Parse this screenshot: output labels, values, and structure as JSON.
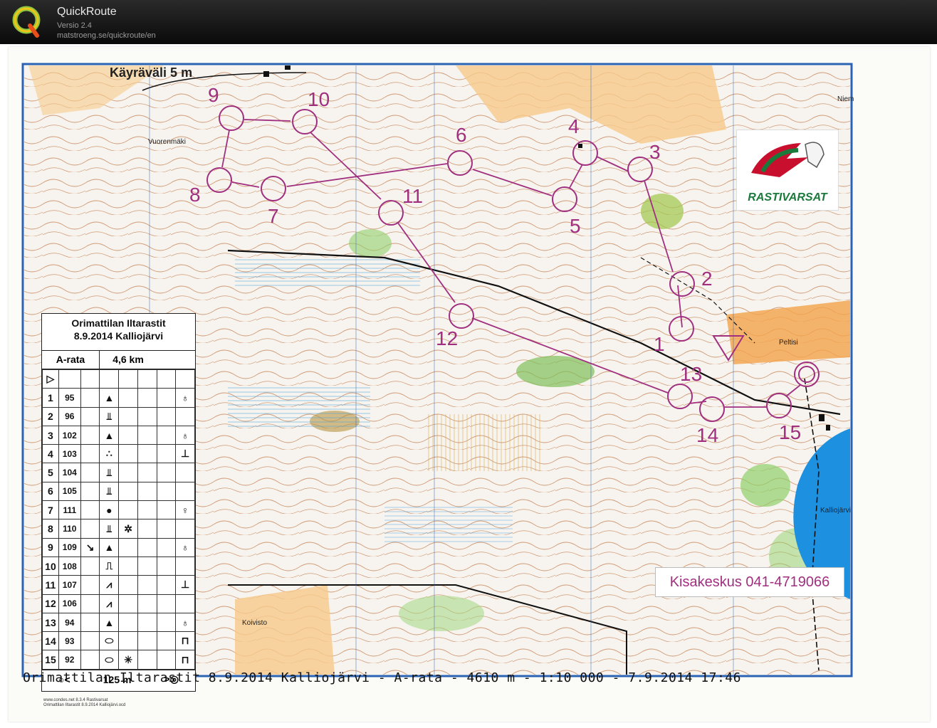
{
  "app": {
    "title": "QuickRoute",
    "version": "Versio 2.4",
    "url": "matstroeng.se/quickroute/en"
  },
  "map": {
    "contour_label": "Käyräväli 5 m",
    "brand": "RASTIVARSAT",
    "hq_label": "Kisakeskus 041-4719066",
    "place_labels": [
      "Vuorenmäki",
      "Koivisto",
      "Peltisi",
      "Kalliojärvi",
      "Niem"
    ],
    "caption": "Orimattilan Iltarastit 8.9.2014 Kalliojärvi - A-rata - 4610 m - 1:10 000 - 7.9.2014 17:46"
  },
  "controls": [
    {
      "n": "1"
    },
    {
      "n": "2"
    },
    {
      "n": "3"
    },
    {
      "n": "4"
    },
    {
      "n": "5"
    },
    {
      "n": "6"
    },
    {
      "n": "7"
    },
    {
      "n": "8"
    },
    {
      "n": "9"
    },
    {
      "n": "10"
    },
    {
      "n": "11"
    },
    {
      "n": "12"
    },
    {
      "n": "13"
    },
    {
      "n": "14"
    },
    {
      "n": "15"
    }
  ],
  "legend": {
    "event_line1": "Orimattilan Iltarastit",
    "event_line2": "8.9.2014 Kalliojärvi",
    "course_name": "A-rata",
    "course_length": "4,6 km",
    "start_symbol": "▷",
    "rows": [
      {
        "num": "1",
        "code": "95",
        "c": "",
        "d": "▲",
        "e": "",
        "h": "♁"
      },
      {
        "num": "2",
        "code": "96",
        "c": "",
        "d": "⫫",
        "e": "",
        "h": ""
      },
      {
        "num": "3",
        "code": "102",
        "c": "",
        "d": "▲",
        "e": "",
        "h": "♁"
      },
      {
        "num": "4",
        "code": "103",
        "c": "",
        "d": "∴",
        "e": "",
        "h": "⊥"
      },
      {
        "num": "5",
        "code": "104",
        "c": "",
        "d": "⫫",
        "e": "",
        "h": ""
      },
      {
        "num": "6",
        "code": "105",
        "c": "",
        "d": "⫫",
        "e": "",
        "h": ""
      },
      {
        "num": "7",
        "code": "111",
        "c": "",
        "d": "●",
        "e": "",
        "h": "♀"
      },
      {
        "num": "8",
        "code": "110",
        "c": "",
        "d": "⫫",
        "e": "✲",
        "h": ""
      },
      {
        "num": "9",
        "code": "109",
        "c": "↘",
        "d": "▲",
        "e": "",
        "h": "♁"
      },
      {
        "num": "10",
        "code": "108",
        "c": "",
        "d": "⎍",
        "e": "",
        "h": ""
      },
      {
        "num": "11",
        "code": "107",
        "c": "",
        "d": "⩘",
        "e": "",
        "h": "⊥"
      },
      {
        "num": "12",
        "code": "106",
        "c": "",
        "d": "⩘",
        "e": "",
        "h": ""
      },
      {
        "num": "13",
        "code": "94",
        "c": "",
        "d": "▲",
        "e": "",
        "h": "♁"
      },
      {
        "num": "14",
        "code": "93",
        "c": "",
        "d": "⬭",
        "e": "",
        "h": "⊓"
      },
      {
        "num": "15",
        "code": "92",
        "c": "",
        "d": "⬭",
        "e": "✳",
        "h": "⊓"
      }
    ],
    "finish_left": "○<",
    "finish_distance": "125 m",
    "finish_right": ">◎",
    "credits_line1": "www.condes.net 8.3.4 Rastivarsat",
    "credits_line2": "Orimattilan Iltarastit 8.9.2014 Kalliojärvi.ocd"
  },
  "colors": {
    "course": "#a0307f",
    "contour": "#b9643a",
    "water": "#3fa0e0",
    "open": "#f2b86a",
    "forest_green": "#8fcf6a"
  }
}
